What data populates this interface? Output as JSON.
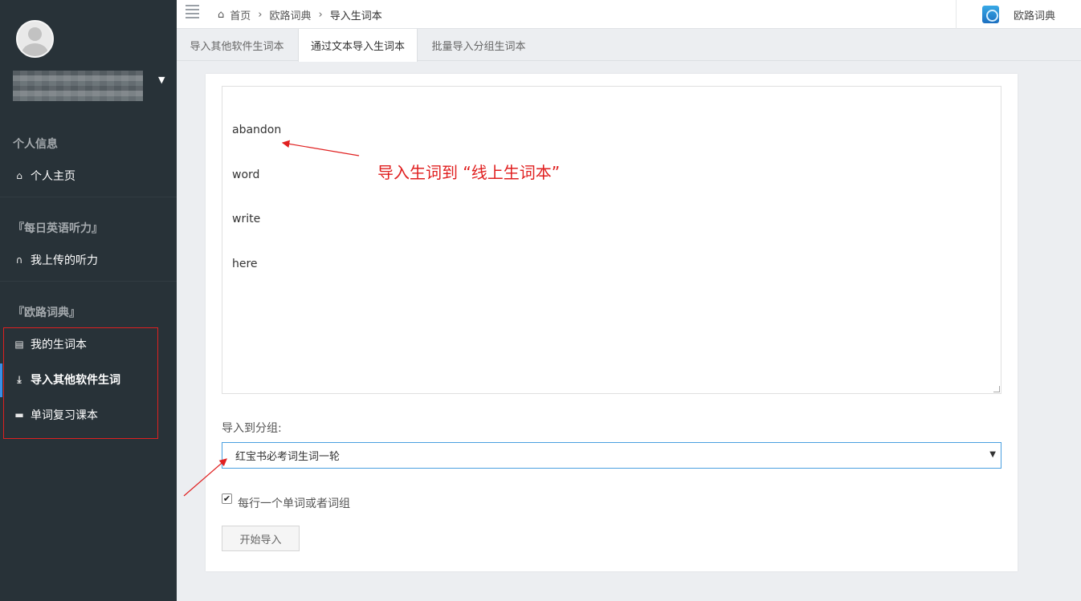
{
  "sidebar": {
    "sections": {
      "personal": "个人信息",
      "listening": "『每日英语听力』",
      "dict": "『欧路词典』"
    },
    "items": [
      {
        "label": "个人主页",
        "icon": "home-icon"
      },
      {
        "label": "我上传的听力",
        "icon": "headphones-icon"
      },
      {
        "label": "我的生词本",
        "icon": "document-icon"
      },
      {
        "label": "导入其他软件生词",
        "icon": "download-icon"
      },
      {
        "label": "单词复习课本",
        "icon": "folder-icon"
      }
    ]
  },
  "breadcrumb": {
    "home": "首页",
    "level1": "欧路词典",
    "level2": "导入生词本"
  },
  "top_right": {
    "label": "欧路词典",
    "icon": "eudic-logo-icon"
  },
  "tabs": [
    {
      "label": "导入其他软件生词本"
    },
    {
      "label": "通过文本导入生词本"
    },
    {
      "label": "批量导入分组生词本"
    }
  ],
  "form": {
    "words": [
      "abandon",
      "word",
      "write",
      "here"
    ],
    "annotation": "导入生词到 “线上生词本”",
    "group_label": "导入到分组:",
    "group_selected": "红宝书必考词生词一轮",
    "checkbox_label": "每行一个单词或者词组",
    "checkbox_checked": true,
    "start_button": "开始导入"
  },
  "colors": {
    "sidebar_bg": "#283238",
    "annotation_red": "#e02020",
    "select_border": "#4aa0e0",
    "active_bar": "#3a8ee6"
  }
}
